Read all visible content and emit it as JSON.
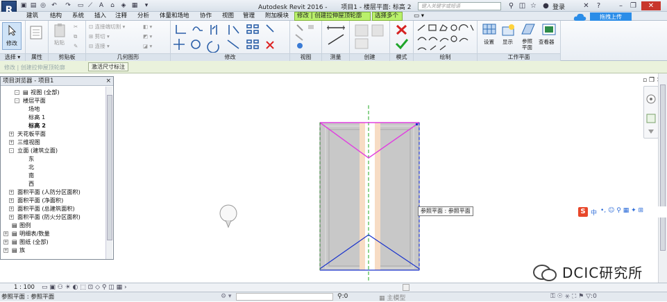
{
  "app": {
    "logo_letter": "R",
    "title": "Autodesk Revit 2016 -",
    "window_title": "项目1 - 楼层平面: 标高 2",
    "search_placeholder": "键入关键字或短语",
    "login": "登录"
  },
  "menu": {
    "items": [
      "建筑",
      "结构",
      "系统",
      "插入",
      "注释",
      "分析",
      "体量和场地",
      "协作",
      "视图",
      "管理",
      "附加模块"
    ],
    "context_tab": "修改 | 创建拉伸屋顶轮廓",
    "select_multi_tab": "选择多个",
    "cloud_upload": "拖拽上传"
  },
  "ribbon": {
    "modify_label": "修改",
    "panels": {
      "select": "选择",
      "properties": "属性",
      "clipboard": "剪贴板",
      "geometry": "几何图形",
      "modify": "修改",
      "view": "视图",
      "measure": "测量",
      "create": "创建",
      "mode": "模式",
      "draw": "绘制",
      "workplane": "工作平面"
    },
    "clipboard": {
      "paste": "粘贴"
    },
    "geometry": {
      "join_cut": "连接端切割",
      "cut": "剪切",
      "join": "连接"
    },
    "workplane": {
      "set": "设置",
      "show": "显示",
      "ref_plane": "参照",
      "ref_plane2": "平面",
      "viewer": "查看器"
    }
  },
  "options_bar": {
    "label": "修改 | 创建拉伸屋顶轮廓",
    "activate_dim": "激活尺寸标注"
  },
  "project_browser": {
    "title": "项目浏览器 - 项目1",
    "close": "×",
    "items": [
      {
        "label": "视图 (全部)",
        "exp": "-"
      },
      {
        "label": "楼层平面",
        "exp": "-"
      },
      {
        "label": "场地",
        "exp": ""
      },
      {
        "label": "标高 1",
        "exp": ""
      },
      {
        "label": "标高 2",
        "exp": ""
      },
      {
        "label": "天花板平面",
        "exp": "+"
      },
      {
        "label": "三维视图",
        "exp": "+"
      },
      {
        "label": "立面 (建筑立面)",
        "exp": "-"
      },
      {
        "label": "东",
        "exp": ""
      },
      {
        "label": "北",
        "exp": ""
      },
      {
        "label": "南",
        "exp": ""
      },
      {
        "label": "西",
        "exp": ""
      },
      {
        "label": "面积平面 (人防分区面积)",
        "exp": "+"
      },
      {
        "label": "面积平面 (净面积)",
        "exp": "+"
      },
      {
        "label": "面积平面 (总建筑面积)",
        "exp": "+"
      },
      {
        "label": "面积平面 (防火分区面积)",
        "exp": "+"
      },
      {
        "label": "图例",
        "exp": ""
      },
      {
        "label": "明细表/数量",
        "exp": "+"
      },
      {
        "label": "图纸 (全部)",
        "exp": "+"
      },
      {
        "label": "族",
        "exp": "+"
      }
    ]
  },
  "canvas": {
    "tooltip": "参照平面 : 参照平面"
  },
  "view_control": {
    "scale": "1 : 100"
  },
  "status": {
    "text": "参照平面 : 参照平面",
    "filter_count": ":0",
    "model": "主模型"
  },
  "ime": {
    "label": "中"
  },
  "watermark": {
    "text": "DCIC研究所"
  },
  "colors": {
    "context_tab": "#b9f06b",
    "roof_outline": "#e040e0",
    "ref_plane": "#1a33cc",
    "center_line": "#22a822"
  }
}
